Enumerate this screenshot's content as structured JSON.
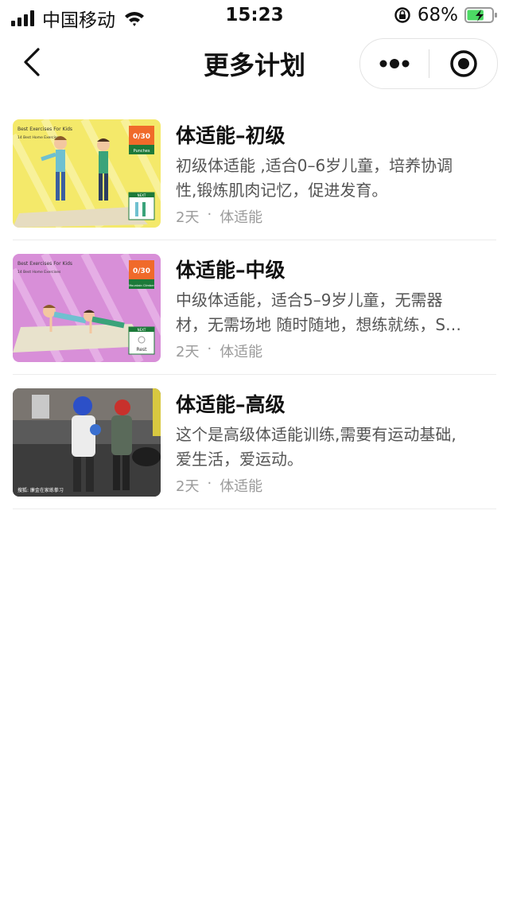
{
  "status_bar": {
    "carrier": "中国移动",
    "time": "15:23",
    "battery_percent": "68%",
    "signal_bars": 4,
    "wifi_icon": "wifi-icon",
    "orientation_lock_icon": "orientation-lock-icon",
    "battery_level": 0.68,
    "battery_color": "#4cd964"
  },
  "nav": {
    "title": "更多计划",
    "back_icon": "chevron-left-icon",
    "more_icon": "more-dots-icon",
    "close_icon": "target-close-icon"
  },
  "plans": [
    {
      "title": "体适能–初级",
      "description": "初级体适能 ,适合0–6岁儿童，培养协调性,锻炼肌肉记忆，促进发育。",
      "duration": "2天",
      "separator": "·",
      "category": "体适能",
      "thumb": {
        "caption": "Best Exercises For Kids",
        "subcaption": "14 Best Home Exercises",
        "counter": "0/30",
        "exercise": "Punches",
        "next": "NEXT",
        "bg": "#f4e96a"
      }
    },
    {
      "title": "体适能–中级",
      "description": "中级体适能，适合5–9岁儿童，无需器材，无需场地 随时随地，想练就练，S…",
      "duration": "2天",
      "separator": "·",
      "category": "体适能",
      "thumb": {
        "caption": "Best Exercises For Kids",
        "subcaption": "14 Best Home Exercises",
        "counter": "0/30",
        "exercise": "Mountain Climber",
        "next": "NEXT",
        "rest": "Rest",
        "bg": "#d88fd8"
      }
    },
    {
      "title": "体适能–高级",
      "description": "这个是高级体适能训练,需要有运动基础,爱生活，爱运动。",
      "duration": "2天",
      "separator": "·",
      "category": "体适能",
      "thumb": {
        "watermark": "搜狐: 廉金在家练拳习",
        "bg": "#4a4a4a"
      }
    }
  ]
}
